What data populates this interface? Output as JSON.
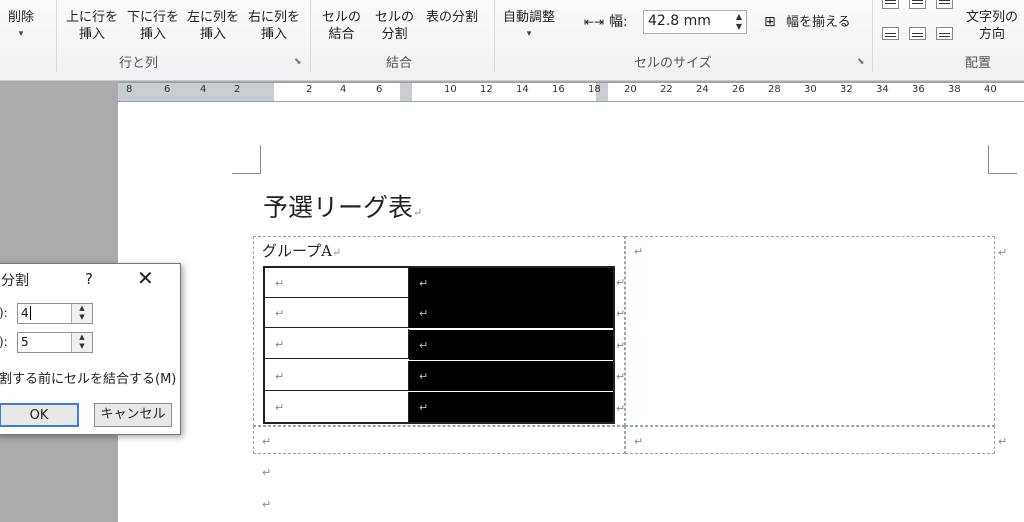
{
  "ribbon": {
    "delete": {
      "label": "削除",
      "arrow": "▾"
    },
    "insert_above": {
      "line1": "上に行を",
      "line2": "挿入"
    },
    "insert_below": {
      "line1": "下に行を",
      "line2": "挿入"
    },
    "insert_left": {
      "line1": "左に列を",
      "line2": "挿入"
    },
    "insert_right": {
      "line1": "右に列を",
      "line2": "挿入"
    },
    "group_rows_cols": "行と列",
    "merge_cells": {
      "line1": "セルの",
      "line2": "結合"
    },
    "split_cells": {
      "line1": "セルの",
      "line2": "分割"
    },
    "split_table": "表の分割",
    "group_merge": "結合",
    "autofit": {
      "label": "自動調整",
      "arrow": "▾"
    },
    "width_label": "幅:",
    "width_value": "42.8 mm",
    "distribute_columns": "幅を揃える",
    "group_cell_size": "セルのサイズ",
    "text_direction": {
      "line1": "文字列の",
      "line2": "方向"
    },
    "group_alignment": "配置"
  },
  "ruler": {
    "numbers": [
      "8",
      "6",
      "4",
      "2",
      "2",
      "4",
      "6",
      "10",
      "12",
      "14",
      "16",
      "18",
      "20",
      "22",
      "24",
      "26",
      "28",
      "30",
      "32",
      "34",
      "36",
      "38",
      "40"
    ]
  },
  "document": {
    "title": "予選リーグ表",
    "group_label": "グループA",
    "para_mark": "↵"
  },
  "dialog": {
    "title": "分割",
    "help": "?",
    "close": "✕",
    "row1_label": "):",
    "cols_value": "4",
    "row2_label": "):",
    "rows_value": "5",
    "merge_option": "割する前にセルを結合する(M)",
    "ok": "OK",
    "cancel": "キャンセル"
  }
}
